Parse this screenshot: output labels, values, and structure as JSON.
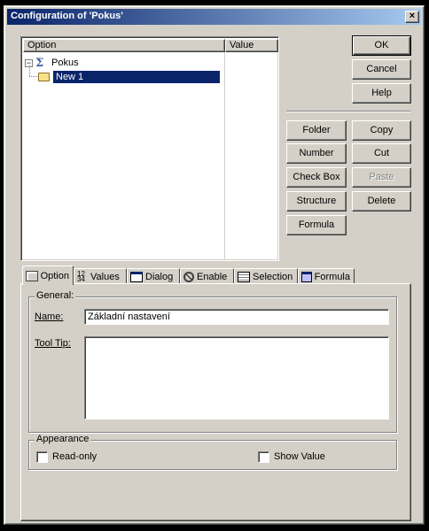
{
  "window": {
    "title": "Configuration of 'Pokus'"
  },
  "tree": {
    "columns": [
      "Option",
      "Value"
    ],
    "items": [
      {
        "label": "Pokus",
        "icon": "sigma-icon",
        "expanded": true,
        "selected": false
      },
      {
        "label": "New 1",
        "icon": "folder-icon",
        "selected": true
      }
    ]
  },
  "buttons": {
    "ok": "OK",
    "cancel": "Cancel",
    "help": "Help",
    "folder": "Folder",
    "copy": "Copy",
    "number": "Number",
    "cut": "Cut",
    "checkbox": "Check Box",
    "paste": "Paste",
    "structure": "Structure",
    "delete": "Delete",
    "formula": "Formula"
  },
  "tabs": [
    {
      "label": "Option",
      "icon": "option-icon",
      "active": true
    },
    {
      "label": "Values",
      "icon": "values-icon",
      "active": false
    },
    {
      "label": "Dialog",
      "icon": "dialog-icon",
      "active": false
    },
    {
      "label": "Enable",
      "icon": "enable-icon",
      "active": false
    },
    {
      "label": "Selection",
      "icon": "selection-icon",
      "active": false
    },
    {
      "label": "Formula",
      "icon": "formula-icon",
      "active": false
    }
  ],
  "general": {
    "group_label": "General:",
    "name_label": "Name:",
    "name_value": "Základní nastavení",
    "tooltip_label": "Tool Tip:",
    "tooltip_value": ""
  },
  "appearance": {
    "group_label": "Appearance",
    "readonly_label": "Read-only",
    "readonly_checked": false,
    "showvalue_label": "Show Value",
    "showvalue_checked": false
  },
  "colors": {
    "face": "#d4d0c8",
    "title_start": "#0a246a",
    "title_end": "#a6caf0",
    "selection": "#0a246a"
  }
}
